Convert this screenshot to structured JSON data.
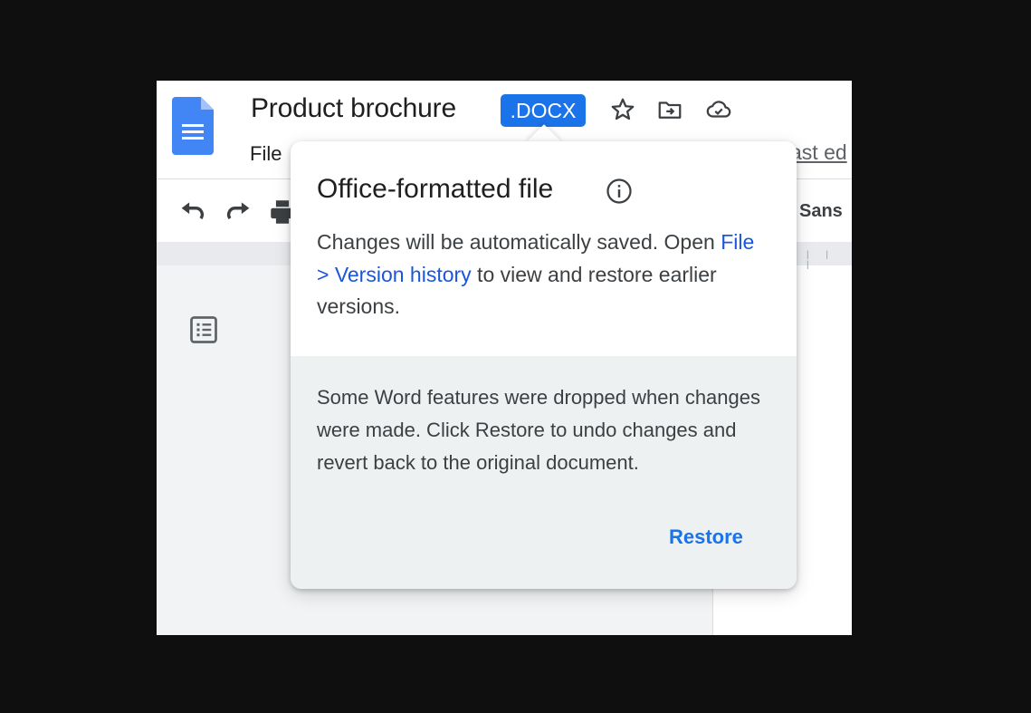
{
  "app": {
    "title": "Product brochure",
    "badge": ".DOCX",
    "menu": {
      "file_label": "File"
    },
    "last_edit_fragment": "ast ed",
    "toolbar": {
      "font_label": "Sans"
    }
  },
  "popover": {
    "title": "Office-formatted file",
    "body_prefix": "Changes will be automatically saved. Open ",
    "body_link": "File > Version history",
    "body_suffix": " to view and restore earlier versions.",
    "warning": "Some Word features were dropped when changes were made. Click Restore to undo changes and revert back to the original document.",
    "restore_label": "Restore"
  },
  "colors": {
    "accent": "#1a73e8",
    "link": "#1a56db",
    "popover_lower_bg": "#eef1f2",
    "backdrop": "#0f0f0f"
  },
  "icons": [
    "docs-logo-icon",
    "star-icon",
    "move-to-folder-icon",
    "cloud-saved-icon",
    "undo-icon",
    "redo-icon",
    "print-icon",
    "outline-icon",
    "info-icon"
  ]
}
